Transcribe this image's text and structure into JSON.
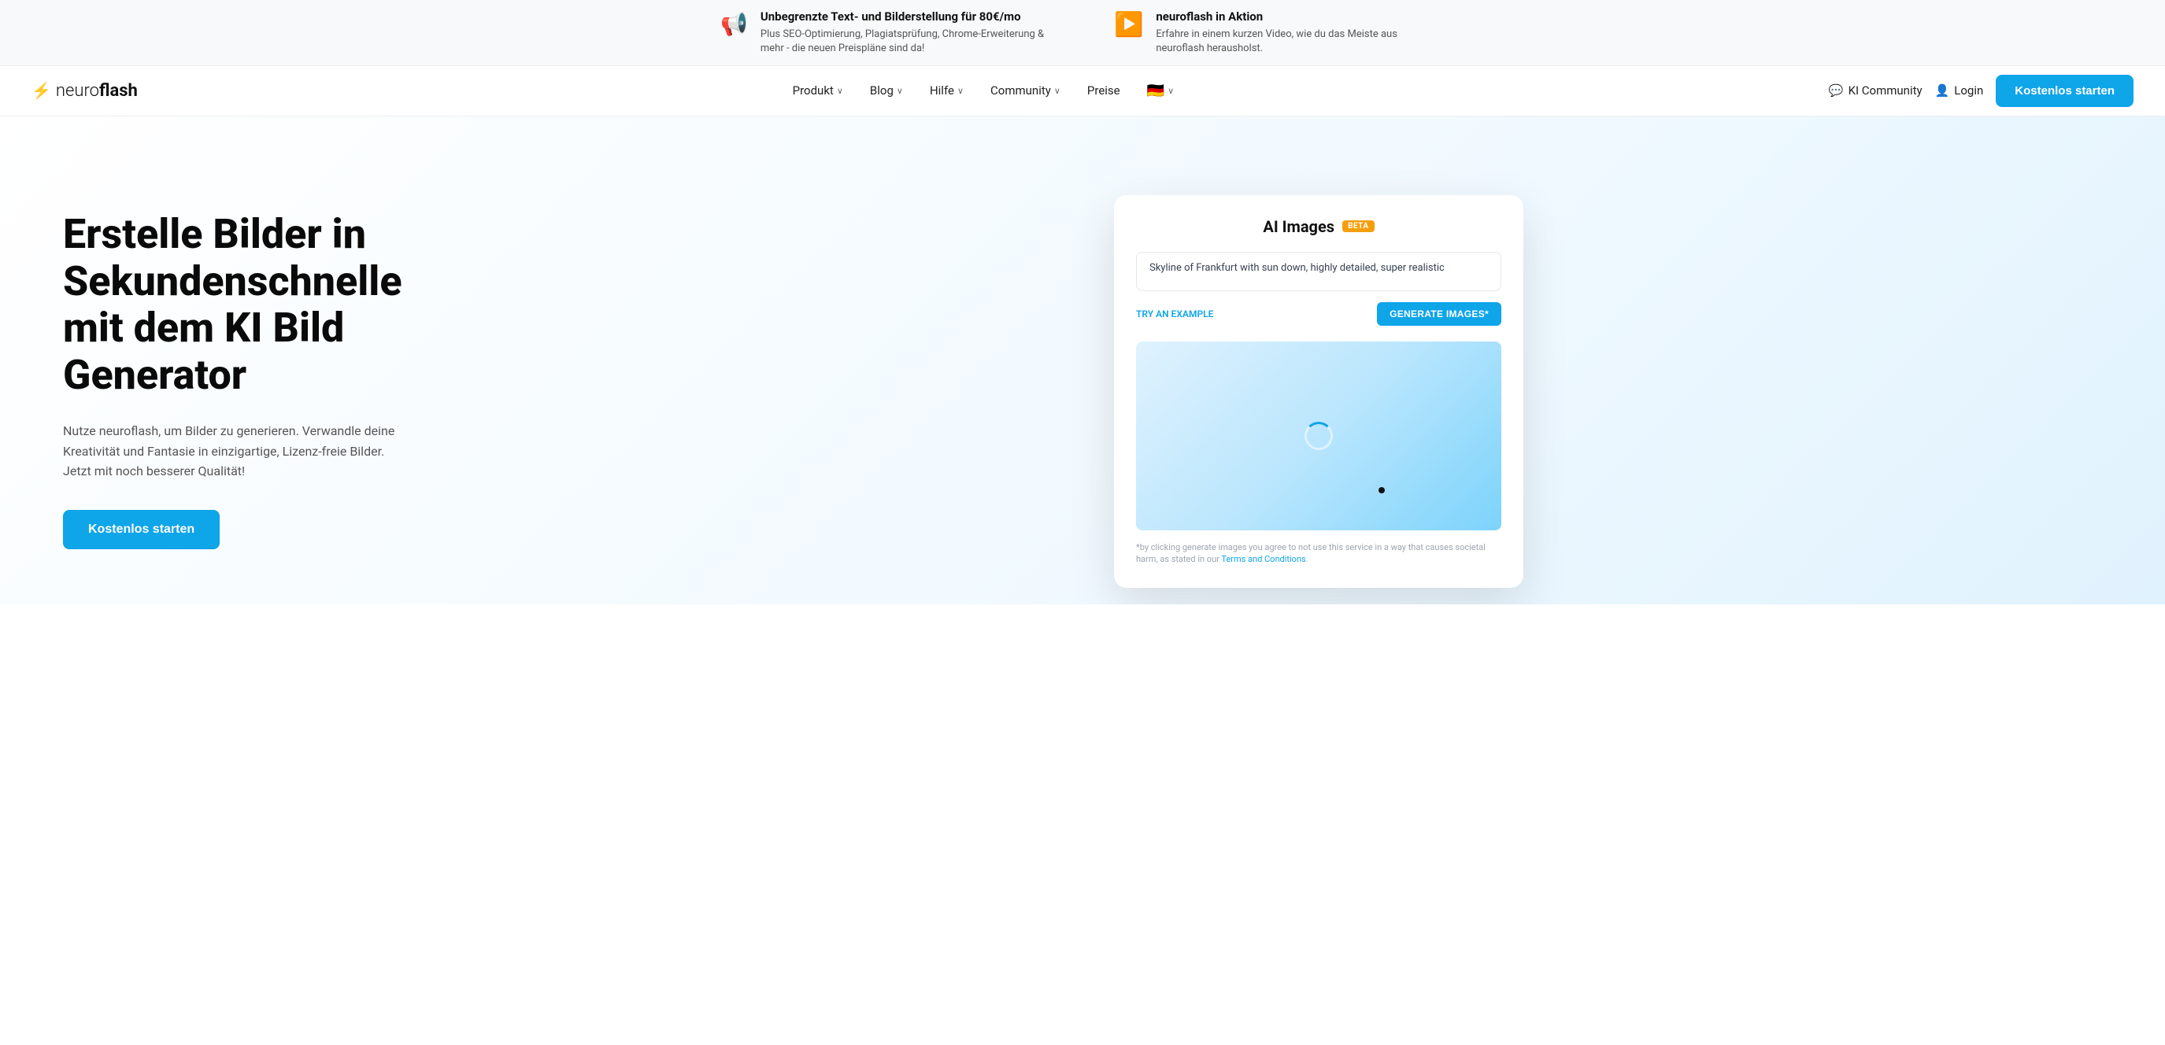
{
  "banner": {
    "item1": {
      "icon": "📢",
      "title": "Unbegrenzte Text- und Bilderstellung für 80€/mo",
      "subtitle": "Plus SEO-Optimierung, Plagiatsprüfung, Chrome-Erweiterung & mehr - die neuen Preispläne sind da!"
    },
    "item2": {
      "icon": "▶",
      "title": "neuroflash in Aktion",
      "subtitle": "Erfahre in einem kurzen Video, wie du das Meiste aus neuroflash herausholst."
    }
  },
  "nav": {
    "logo_prefix": "neuro",
    "logo_suffix": "flash",
    "links": [
      {
        "label": "Produkt",
        "has_dropdown": true
      },
      {
        "label": "Blog",
        "has_dropdown": true
      },
      {
        "label": "Hilfe",
        "has_dropdown": true
      },
      {
        "label": "Community",
        "has_dropdown": true
      },
      {
        "label": "Preise",
        "has_dropdown": false
      }
    ],
    "flag": "🇩🇪",
    "ki_community_label": "KI Community",
    "login_label": "Login",
    "cta_label": "Kostenlos starten"
  },
  "hero": {
    "title": "Erstelle Bilder in Sekundenschnelle mit dem KI Bild Generator",
    "subtitle": "Nutze neuroflash, um Bilder zu generieren. Verwandle deine Kreativität und Fantasie in einzigartige, Lizenz-freie Bilder. Jetzt mit noch besserer Qualität!",
    "cta_label": "Kostenlos starten"
  },
  "app_card": {
    "title": "AI Images",
    "beta_label": "BETA",
    "input_value": "Skyline of Frankfurt with sun down, highly detailed, super realistic",
    "try_example_label": "TRY AN EXAMPLE",
    "generate_label": "GENERATE IMAGES*",
    "footer_text": "*by clicking generate images you agree to not use this service in a way that causes societal harm, as stated in our ",
    "footer_link_label": "Terms and Conditions",
    "footer_link_end": "."
  },
  "icons": {
    "chat_icon": "💬",
    "user_icon": "👤",
    "chevron": "∨"
  }
}
